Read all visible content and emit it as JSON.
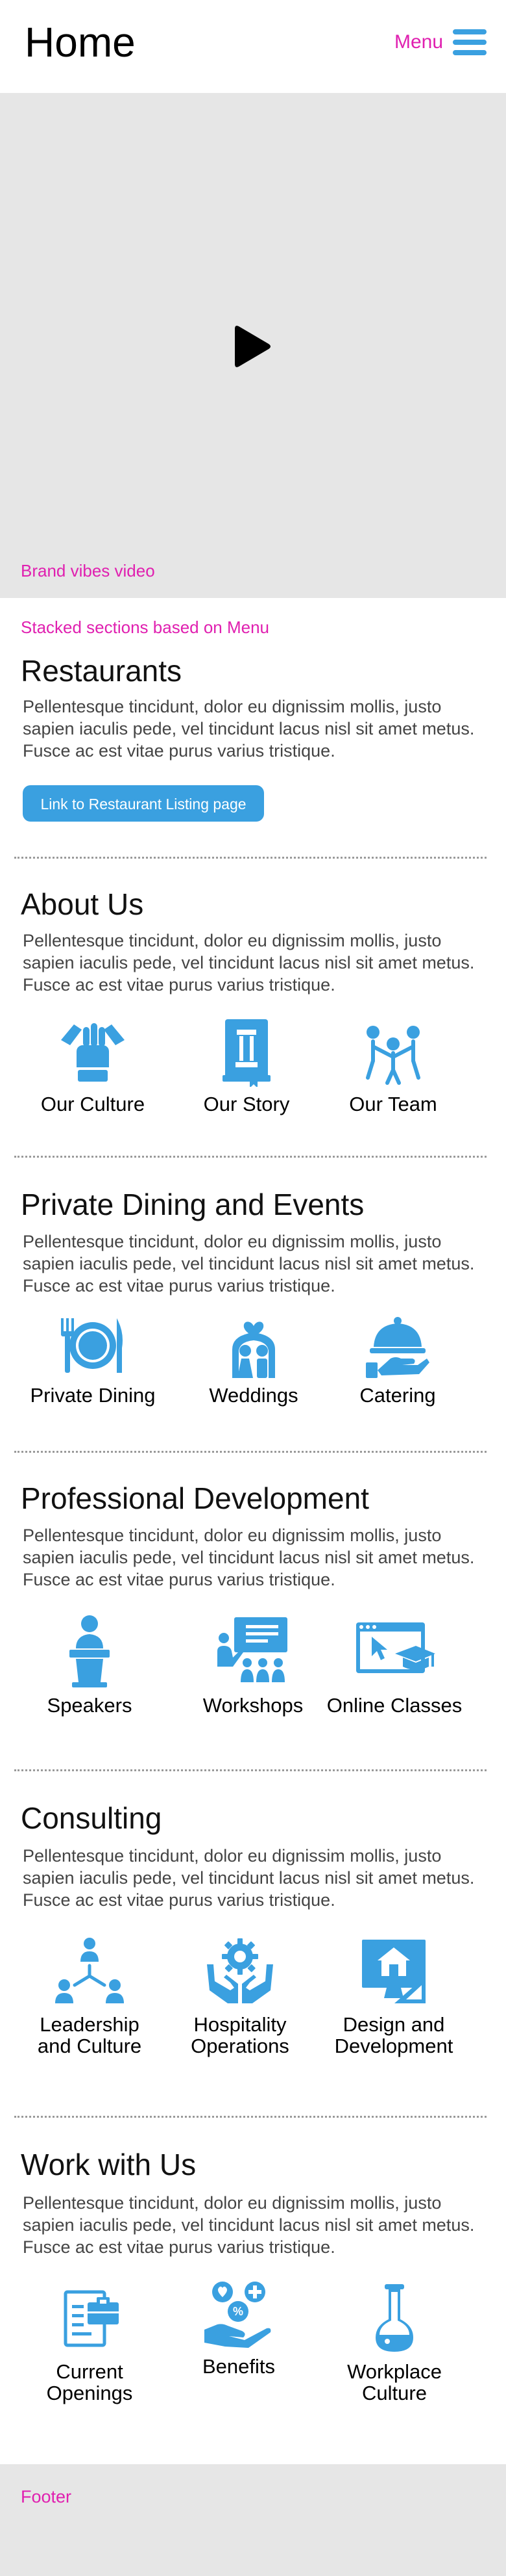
{
  "header": {
    "title": "Home",
    "menu_label": "Menu"
  },
  "hero": {
    "video_label": "Brand vibes video"
  },
  "stacked_label": "Stacked sections based on Menu",
  "lorem": "Pellentesque tincidunt, dolor eu dignissim mollis, justo sapien iaculis pede, vel tincidunt lacus nisl sit amet metus. Fusce ac est vitae purus varius tristique.",
  "restaurants": {
    "title": "Restaurants",
    "body": "Pellentesque tincidunt, dolor eu dignissim mollis, justo sapien iaculis pede, vel tincidunt lacus nisl sit amet metus. Fusce ac est vitae purus varius tristique.",
    "button": "Link to Restaurant Listing page"
  },
  "about": {
    "title": "About Us",
    "body": "Pellentesque tincidunt, dolor eu dignissim mollis, justo sapien iaculis pede, vel tincidunt lacus nisl sit amet metus. Fusce ac est vitae purus varius tristique.",
    "items": [
      {
        "label": "Our Culture",
        "icon": "hands-together-icon"
      },
      {
        "label": "Our Story",
        "icon": "book-pillar-icon"
      },
      {
        "label": "Our Team",
        "icon": "team-icon"
      }
    ]
  },
  "private_dining": {
    "title": "Private Dining and Events",
    "body": "Pellentesque tincidunt, dolor eu dignissim mollis, justo sapien iaculis pede, vel tincidunt lacus nisl sit amet metus. Fusce ac est vitae purus varius tristique.",
    "items": [
      {
        "label": "Private Dining",
        "icon": "plate-cutlery-icon"
      },
      {
        "label": "Weddings",
        "icon": "wedding-couple-icon"
      },
      {
        "label": "Catering",
        "icon": "cloche-icon"
      }
    ]
  },
  "professional": {
    "title": "Professional Development",
    "body": "Pellentesque tincidunt, dolor eu dignissim mollis, justo sapien iaculis pede, vel tincidunt lacus nisl sit amet metus. Fusce ac est vitae purus varius tristique.",
    "items": [
      {
        "label": "Speakers",
        "icon": "speaker-podium-icon"
      },
      {
        "label": "Workshops",
        "icon": "workshop-presentation-icon"
      },
      {
        "label": "Online Classes",
        "icon": "online-class-icon"
      }
    ]
  },
  "consulting": {
    "title": "Consulting",
    "body": "Pellentesque tincidunt, dolor eu dignissim mollis, justo sapien iaculis pede, vel tincidunt lacus nisl sit amet metus. Fusce ac est vitae purus varius tristique.",
    "items": [
      {
        "label_1": "Leadership",
        "label_2": "and Culture",
        "icon": "org-chart-icon"
      },
      {
        "label_1": "Hospitality",
        "label_2": "Operations",
        "icon": "gear-hands-icon"
      },
      {
        "label_1": "Design and",
        "label_2": "Development",
        "icon": "blueprint-icon"
      }
    ]
  },
  "work": {
    "title": "Work with Us",
    "body": "Pellentesque tincidunt, dolor eu dignissim mollis, justo sapien iaculis pede, vel tincidunt lacus nisl sit amet metus. Fusce ac est vitae purus varius tristique.",
    "items": [
      {
        "label_1": "Current",
        "label_2": "Openings",
        "icon": "job-briefcase-icon"
      },
      {
        "label_1": "Benefits",
        "label_2": "",
        "icon": "benefits-hand-icon"
      },
      {
        "label_1": "Workplace",
        "label_2": "Culture",
        "icon": "flask-icon"
      }
    ]
  },
  "footer": {
    "label": "Footer"
  },
  "colors": {
    "accent": "#3aa0e0",
    "annotation": "#e020b0",
    "placeholder": "#e6e6e6"
  }
}
